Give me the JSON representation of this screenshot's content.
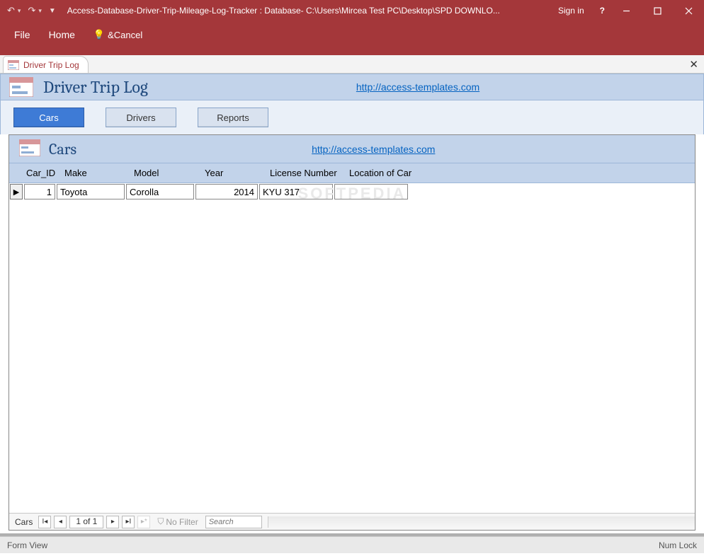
{
  "titlebar": {
    "undo_tip": "Undo",
    "redo_tip": "Redo",
    "title": "Access-Database-Driver-Trip-Mileage-Log-Tracker : Database- C:\\Users\\Mircea Test PC\\Desktop\\SPD DOWNLO...",
    "signin": "Sign in",
    "help": "?"
  },
  "ribbon": {
    "file": "File",
    "home": "Home",
    "tellme": "&Cancel"
  },
  "doctab": {
    "label": "Driver Trip Log"
  },
  "form": {
    "title": "Driver Trip Log",
    "link": "http://access-templates.com",
    "nav": {
      "cars": "Cars",
      "drivers": "Drivers",
      "reports": "Reports"
    }
  },
  "subform": {
    "title": "Cars",
    "link": "http://access-templates.com",
    "columns": {
      "id": "Car_ID",
      "make": "Make",
      "model": "Model",
      "year": "Year",
      "lic": "License Number",
      "loc": "Location of Car"
    },
    "rows": [
      {
        "id": "1",
        "make": "Toyota",
        "model": "Corolla",
        "year": "2014",
        "lic": "KYU 317",
        "loc": ""
      }
    ]
  },
  "watermark": "SOFTPEDIA",
  "recnav": {
    "label": "Cars",
    "pos": "1 of 1",
    "filter": "No Filter",
    "search": "Search"
  },
  "statusbar": {
    "left": "Form View",
    "right": "Num Lock"
  }
}
